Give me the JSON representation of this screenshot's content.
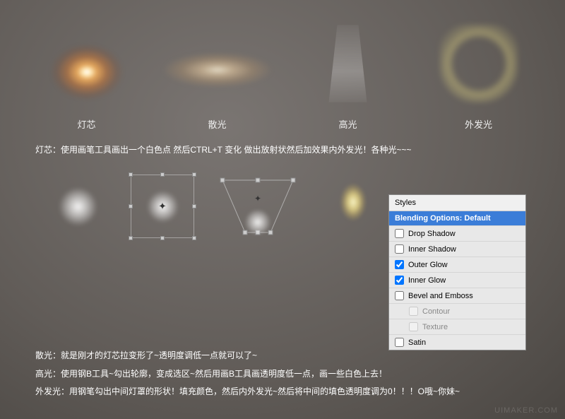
{
  "top_effects": {
    "wick": "灯芯",
    "scatter": "散光",
    "highlight": "高光",
    "outer_glow": "外发光"
  },
  "instructions": {
    "wick": "灯芯：使用画笔工具画出一个白色点 然后CTRL+T 变化 做出放射状然后加效果内外发光！各种光~~~",
    "scatter": "散光：就是刚才的灯芯拉变形了~透明度调低一点就可以了~",
    "highlight": "高光：使用钢B工具~勾出轮廓，变成选区~然后用画B工具画透明度低一点，画一些白色上去！",
    "outer_glow": "外发光：用钢笔勾出中间灯罩的形状！填充颜色，然后内外发光~然后将中间的填色透明度调为0！！！O哦~你妹~"
  },
  "styles_panel": {
    "header": "Styles",
    "blending": "Blending Options: Default",
    "drop_shadow": "Drop Shadow",
    "inner_shadow": "Inner Shadow",
    "outer_glow": "Outer Glow",
    "inner_glow": "Inner Glow",
    "bevel": "Bevel and Emboss",
    "contour": "Contour",
    "texture": "Texture",
    "satin": "Satin"
  },
  "watermark": "UIMAKER.COM"
}
